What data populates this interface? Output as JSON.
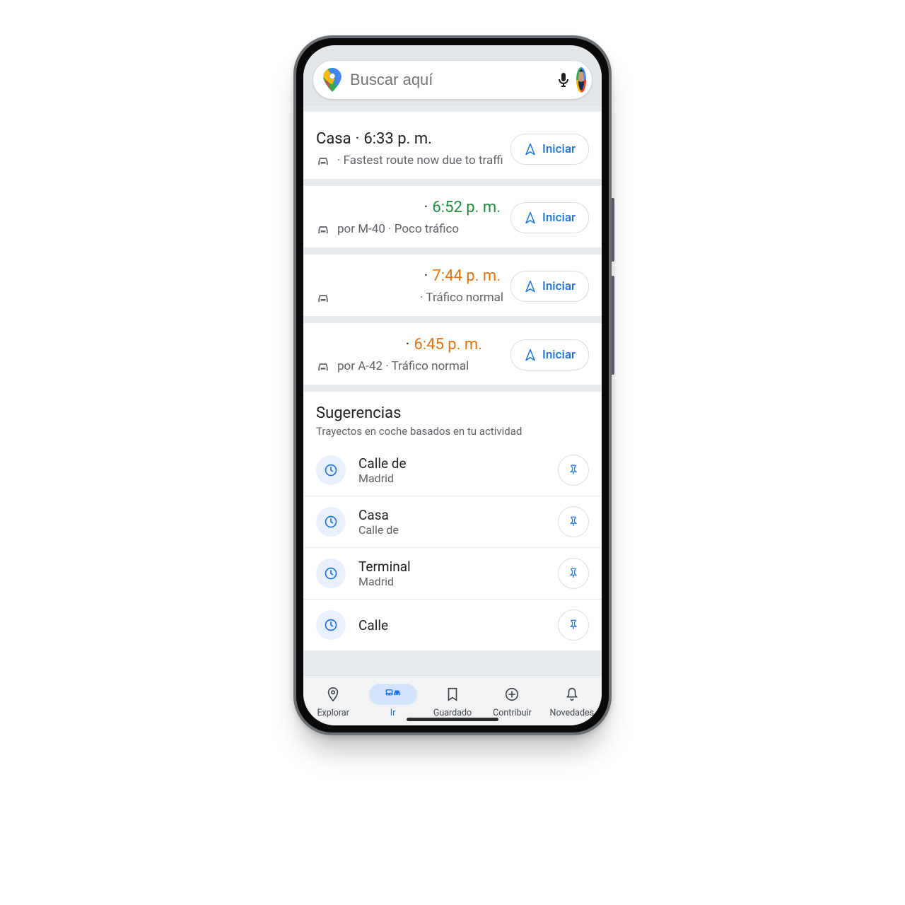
{
  "search": {
    "placeholder": "Buscar aquí"
  },
  "routes": [
    {
      "destination": "Casa",
      "time": "6:33 p. m.",
      "time_color": "black",
      "detail": "· Fastest route now due to traffi",
      "start_label": "Iniciar"
    },
    {
      "destination": "",
      "time": "6:52 p. m.",
      "time_color": "green",
      "detail": "por M-40 · Poco tráfico",
      "start_label": "Iniciar"
    },
    {
      "destination": "",
      "time": "7:44 p. m.",
      "time_color": "orange",
      "detail": "· Tráfico normal",
      "start_label": "Iniciar",
      "no_route_via": true
    },
    {
      "destination": "",
      "time": "6:45 p. m.",
      "time_color": "orange",
      "detail": "por A-42 · Tráfico normal",
      "start_label": "Iniciar"
    }
  ],
  "suggestions": {
    "title": "Sugerencias",
    "subtitle": "Trayectos en coche basados en tu actividad",
    "items": [
      {
        "line1": "Calle de",
        "line2": "Madrid"
      },
      {
        "line1": "Casa",
        "line2": "Calle de"
      },
      {
        "line1": "Terminal",
        "line2": "Madrid"
      },
      {
        "line1": "Calle",
        "line2": ""
      }
    ]
  },
  "nav": {
    "items": [
      {
        "label": "Explorar",
        "id": "explorar"
      },
      {
        "label": "Ir",
        "id": "ir",
        "active": true
      },
      {
        "label": "Guardado",
        "id": "guardado"
      },
      {
        "label": "Contribuir",
        "id": "contribuir"
      },
      {
        "label": "Novedades",
        "id": "novedades"
      }
    ]
  }
}
